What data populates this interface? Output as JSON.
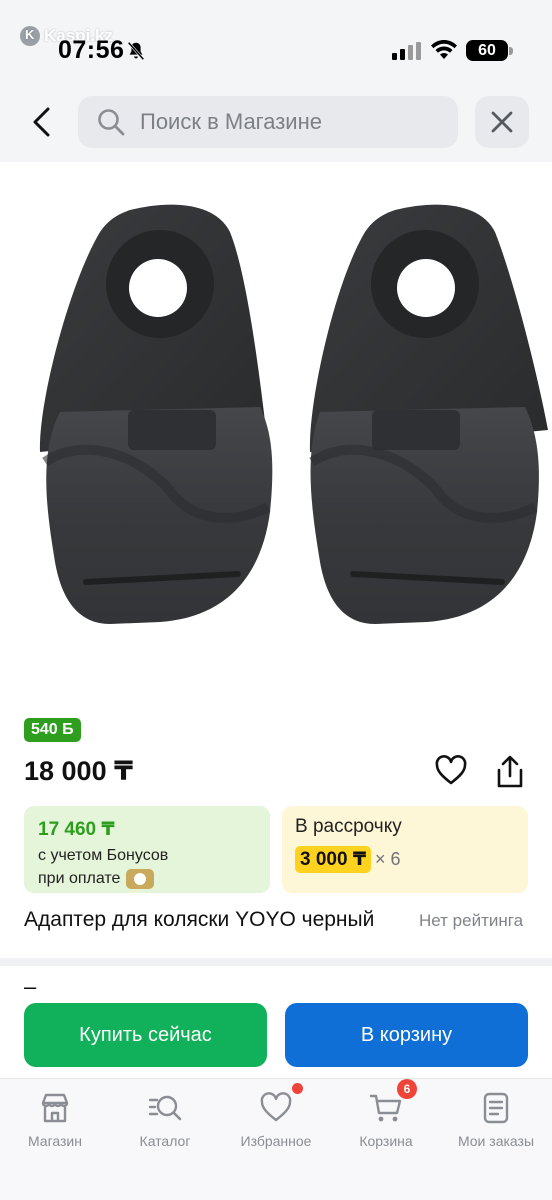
{
  "status_bar": {
    "carrier_label": "Kaspi.kz",
    "time": "07:56",
    "battery": "60"
  },
  "search": {
    "placeholder": "Поиск в Магазине"
  },
  "product": {
    "bonus_badge": "540 Б",
    "price": "18 000 ₸",
    "title": "Адаптер для коляски YOYO черный",
    "rating_text": "Нет рейтинга"
  },
  "bonus_card": {
    "amount": "17 460 ₸",
    "line1": "с учетом Бонусов",
    "line2": "при оплате"
  },
  "installment_card": {
    "title": "В рассрочку",
    "monthly": "3 000 ₸",
    "months": "× 6"
  },
  "section2": {
    "dash": "–"
  },
  "actions": {
    "buy_now": "Купить сейчас",
    "add_to_cart": "В корзину"
  },
  "bottom_nav": {
    "items": [
      {
        "label": "Магазин",
        "icon": "shop-icon"
      },
      {
        "label": "Каталог",
        "icon": "catalog-search-icon"
      },
      {
        "label": "Избранное",
        "icon": "heart-icon",
        "has_dot": true
      },
      {
        "label": "Корзина",
        "icon": "cart-icon",
        "badge": "6"
      },
      {
        "label": "Мои заказы",
        "icon": "orders-icon"
      }
    ]
  },
  "colors": {
    "green_accent": "#2e9e1f",
    "buy_button": "#11b05a",
    "cart_button": "#0f6fd6",
    "installment_chip": "#ffd21f",
    "badge_red": "#f0443a"
  }
}
